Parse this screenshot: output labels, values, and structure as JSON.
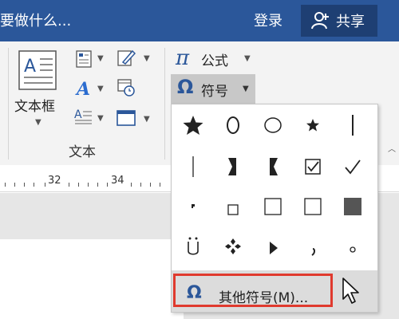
{
  "titlebar": {
    "search_text": "要做什么...",
    "login_label": "登录",
    "share_label": "共享"
  },
  "ribbon": {
    "textbox_label": "文本框",
    "group_label": "文本",
    "formula_label": "公式",
    "symbol_label": "符号",
    "formula_icon": "π",
    "symbol_icon": "Ω"
  },
  "ruler": {
    "numbers": [
      "32",
      "34"
    ]
  },
  "symbols_menu": {
    "rows": [
      [
        "★",
        "O",
        "◯",
        "★",
        "|"
      ],
      [
        "|",
        "◗",
        "◖",
        "☑",
        "✓"
      ],
      [
        "•",
        "□",
        "□",
        "□",
        "■"
      ],
      [
        "Ü",
        "✥",
        "▶",
        ",",
        "◦"
      ]
    ],
    "more_symbols_label": "其他符号(M)...",
    "more_symbols_icon": "Ω"
  },
  "colors": {
    "titlebar": "#2b579a",
    "share_button": "#1e3f73",
    "highlight_border": "#e03a2e",
    "accent_icon": "#2b579a"
  }
}
